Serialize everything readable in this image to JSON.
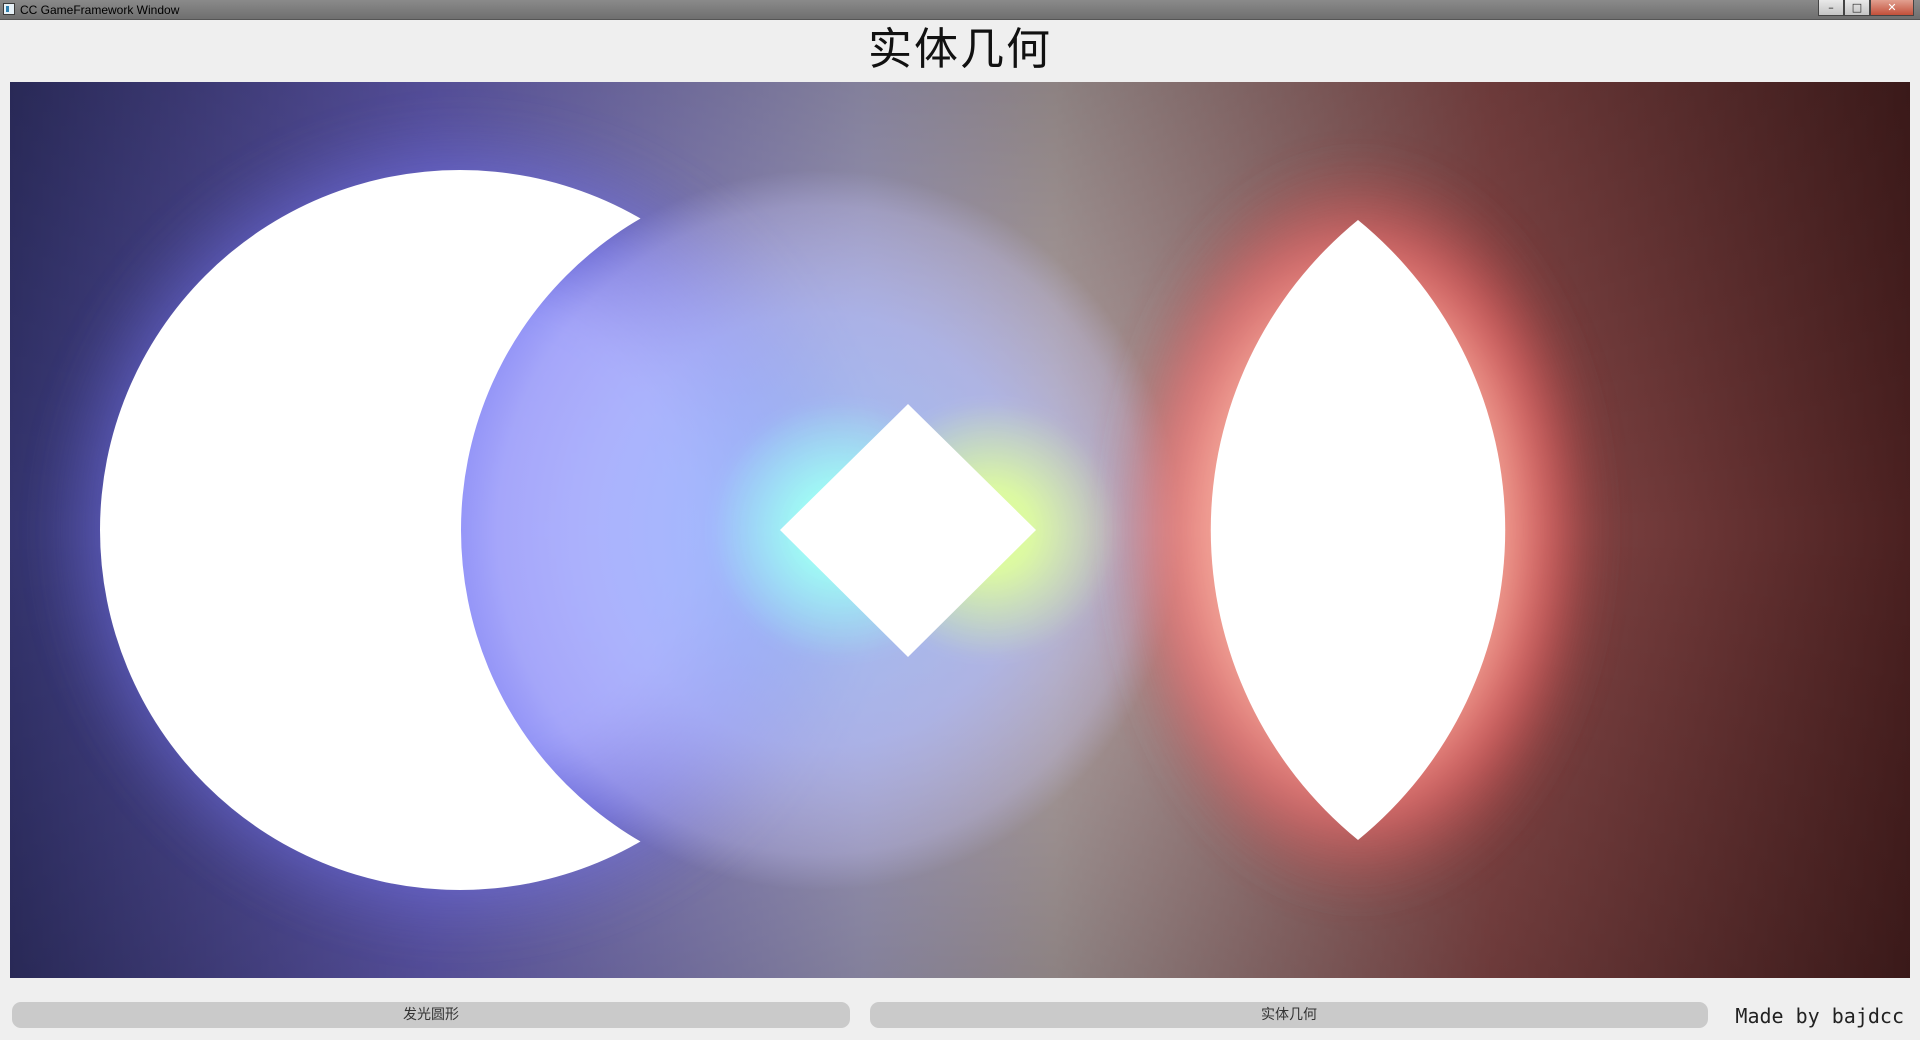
{
  "window": {
    "title": "CC GameFramework Window",
    "controls": {
      "minimize": "–",
      "maximize": "□",
      "close": "✕"
    }
  },
  "heading": "实体几何",
  "canvas": {
    "background_left": "#34346e",
    "background_center": "#9a96a4",
    "background_right": "#4a2020",
    "glow_blue": "#6e6ef5",
    "glow_red": "#ff6060",
    "glow_cyan": "#9ff8f0",
    "glow_yellow": "#d9f59a",
    "shape_fill": "#ffffff",
    "shapes": [
      "crescent",
      "diamond",
      "lens"
    ]
  },
  "buttons": {
    "left": "发光圆形",
    "right": "实体几何"
  },
  "credit": "Made by bajdcc"
}
